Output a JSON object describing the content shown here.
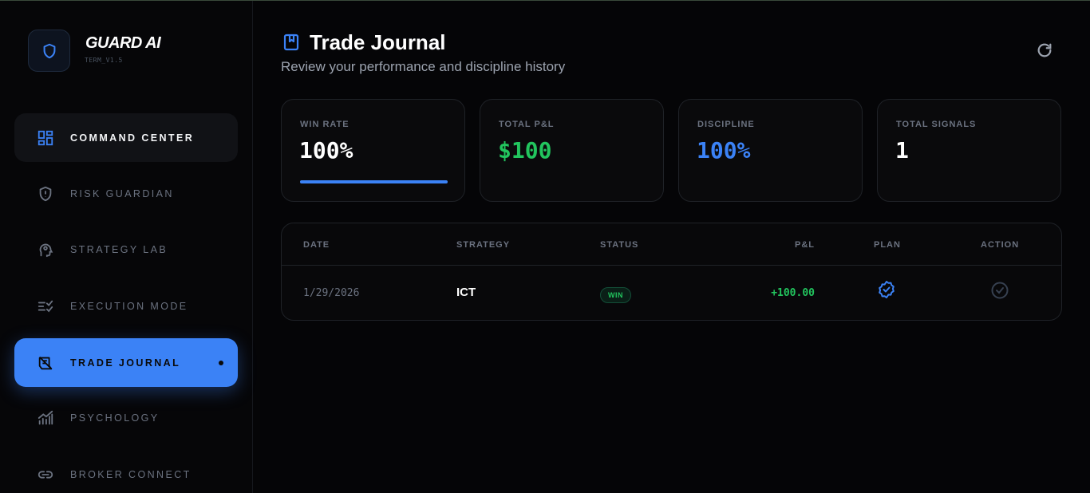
{
  "brand": {
    "name": "GUARD AI",
    "version": "TERM_V1.5",
    "logo_icon": "shield-icon"
  },
  "sidebar": {
    "items": [
      {
        "label": "COMMAND CENTER",
        "icon": "dashboard-grid-icon",
        "state": "hover"
      },
      {
        "label": "RISK GUARDIAN",
        "icon": "shield-alert-icon",
        "state": "default"
      },
      {
        "label": "STRATEGY LAB",
        "icon": "brain-gear-icon",
        "state": "default"
      },
      {
        "label": "EXECUTION MODE",
        "icon": "list-check-icon",
        "state": "default"
      },
      {
        "label": "TRADE JOURNAL",
        "icon": "journal-icon",
        "state": "active"
      },
      {
        "label": "PSYCHOLOGY",
        "icon": "chart-bars-icon",
        "state": "default"
      },
      {
        "label": "BROKER CONNECT",
        "icon": "link-icon",
        "state": "default"
      }
    ]
  },
  "header": {
    "title": "Trade Journal",
    "subtitle": "Review your performance and discipline history",
    "icon": "bookmark-book-icon",
    "refresh_icon": "refresh-icon"
  },
  "stats": [
    {
      "label": "WIN RATE",
      "value": "100%",
      "color": "#ffffff",
      "progress": 1.0
    },
    {
      "label": "TOTAL P&L",
      "value": "$100",
      "color": "#22c55e"
    },
    {
      "label": "DISCIPLINE",
      "value": "100%",
      "color": "#3b82f6"
    },
    {
      "label": "TOTAL SIGNALS",
      "value": "1",
      "color": "#ffffff"
    }
  ],
  "table": {
    "columns": [
      "DATE",
      "STRATEGY",
      "STATUS",
      "P&L",
      "PLAN",
      "ACTION"
    ],
    "rows": [
      {
        "date": "1/29/2026",
        "strategy": "ICT",
        "status": "WIN",
        "pnl": "+100.00",
        "plan_icon": "verified-badge-icon",
        "action_icon": "check-circle-icon"
      }
    ]
  },
  "colors": {
    "accent": "#3b82f6",
    "success": "#22c55e",
    "background": "#050507"
  }
}
